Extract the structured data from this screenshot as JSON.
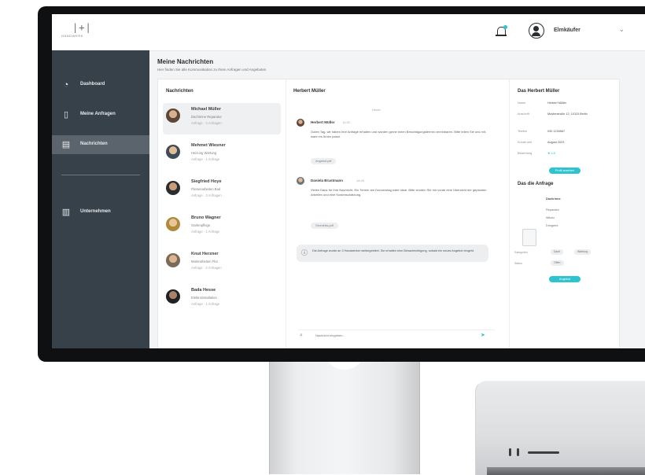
{
  "app": {
    "logo_mark": "|+|",
    "logo_word": "HANDWERK",
    "user_name": "Elmkäufer",
    "colors": {
      "sidebar": "#37414a",
      "sidebar_active": "#5b646c",
      "accent": "#2ec4cf"
    }
  },
  "sidebar": {
    "items": [
      {
        "label": "Dashboard",
        "icon": "gauge-icon"
      },
      {
        "label": "Meine Anfragen",
        "icon": "document-icon"
      },
      {
        "label": "Nachrichten",
        "icon": "chat-icon",
        "active": true
      },
      {
        "label": "Unternehmen",
        "icon": "building-icon"
      }
    ]
  },
  "page": {
    "title": "Meine Nachrichten",
    "subtitle": "Hier finden Sie alle Kommunikation zu Ihren Anfragen und Angeboten"
  },
  "list": {
    "heading": "Nachrichten",
    "contacts": [
      {
        "name": "Michael Müller",
        "line1": "Dachrinne Reparatur",
        "line2": "Anfrage · 2 Anfragen"
      },
      {
        "name": "Mehmet Wiesner",
        "line1": "Heizung Wartung",
        "line2": "Anfrage · 1 Anfrage"
      },
      {
        "name": "Siegfried Hoye",
        "line1": "Fliesenarbeiten Bad",
        "line2": "Anfrage · 3 Anfragen"
      },
      {
        "name": "Bruno Wagner",
        "line1": "Gartenpflege",
        "line2": "Anfrage · 1 Anfrage"
      },
      {
        "name": "Knut Herzner",
        "line1": "Malerarbeiten Flur",
        "line2": "Anfrage · 2 Anfragen"
      },
      {
        "name": "Bada Hesse",
        "line1": "Elektroinstallation",
        "line2": "Anfrage · 1 Anfrage"
      }
    ]
  },
  "chat": {
    "heading": "Herbert Müller",
    "date_separator": "Heute",
    "messages": [
      {
        "sender": "Herbert Müller",
        "time": "14:32",
        "text": "Guten Tag, wir haben Ihre Anfrage erhalten und würden gerne einen Besichtigungstermin vereinbaren. Bitte teilen Sie uns mit, wann es Ihnen passt.",
        "attachment": "Angebot.pdf"
      },
      {
        "sender": "Daniela Brustmann",
        "time": "14:40",
        "text": "Vielen Dank für Ihre Nachricht. Ein Termin am Donnerstag wäre ideal. Bitte senden Sie mir vorab eine Übersicht der geplanten Arbeiten und eine Kostenschätzung.",
        "attachment": "Grundriss.pdf"
      }
    ],
    "system_message": "Die Anfrage wurde an 3 Handwerker weitergeleitet. Sie erhalten eine Benachrichtigung, sobald ein neues Angebot eingeht.",
    "input_placeholder": "Nachricht eingeben..."
  },
  "detail": {
    "heading": "Das Herbert Müller",
    "fields": [
      {
        "key": "Name",
        "value": "Herbert Müller"
      },
      {
        "key": "Anschrift",
        "value": "Musterstraße 12, 10115 Berlin"
      },
      {
        "key": "Telefon",
        "value": "030 1234567"
      },
      {
        "key": "Kunde seit",
        "value": "August 2023"
      },
      {
        "key": "Bewertung",
        "value": "★ 4.8"
      }
    ],
    "profile_button": "Profil ansehen",
    "request_heading": "Das die Anfrage",
    "request_title": "Dachrinne",
    "request_bullets": [
      "Reparatur",
      "Altbau",
      "Dringend"
    ],
    "tags_label": "Kategorien",
    "tags": [
      "Dach",
      "Wartung"
    ],
    "status_label": "Status",
    "status_value": "Offen",
    "action_button": "Angebot"
  }
}
